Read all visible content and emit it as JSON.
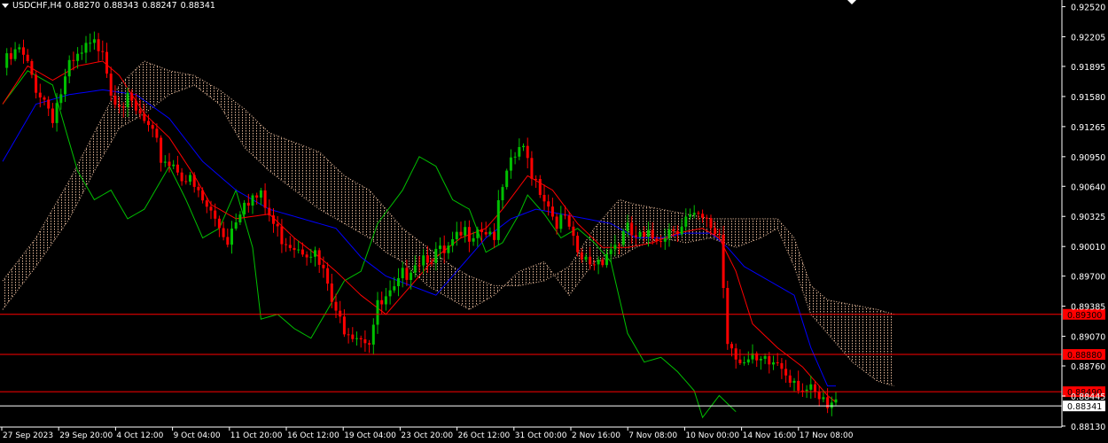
{
  "header": {
    "symbol": "USDCHF,H4",
    "open": "0.88270",
    "high": "0.88343",
    "low": "0.88247",
    "close": "0.88341"
  },
  "colors": {
    "background": "#000000",
    "bull_candle": "#00c000",
    "bear_candle": "#ff0000",
    "tenkan": "#ff0000",
    "kijun": "#0000ff",
    "chikou": "#00c000",
    "cloud_dots": "#f5c6a5",
    "level_line": "#ff0000",
    "price_line": "#ffffff"
  },
  "chart_data": {
    "type": "candlestick",
    "symbol": "USDCHF",
    "timeframe": "H4",
    "ylim": [
      0.8812,
      0.9259
    ],
    "y_ticks": [
      "0.92520",
      "0.92205",
      "0.91895",
      "0.91580",
      "0.91265",
      "0.90950",
      "0.90640",
      "0.90325",
      "0.90010",
      "0.89700",
      "0.89385",
      "0.89070",
      "0.88760",
      "0.88445",
      "0.88130"
    ],
    "x_ticks": [
      "27 Sep 2023",
      "29 Sep 20:00",
      "4 Oct 12:00",
      "9 Oct 04:00",
      "11 Oct 20:00",
      "16 Oct 12:00",
      "19 Oct 04:00",
      "23 Oct 20:00",
      "26 Oct 12:00",
      "31 Oct 00:00",
      "2 Nov 16:00",
      "7 Nov 08:00",
      "10 Nov 00:00",
      "14 Nov 16:00",
      "17 Nov 08:00"
    ],
    "horizontal_levels": [
      {
        "label": "0.89300",
        "value": 0.893
      },
      {
        "label": "0.88880",
        "value": 0.8888
      },
      {
        "label": "0.88490",
        "value": 0.8849
      }
    ],
    "current_price": {
      "label": "0.88341",
      "value": 0.88341
    },
    "close_path": [
      [
        0,
        0.9188
      ],
      [
        4,
        0.9205
      ],
      [
        8,
        0.917
      ],
      [
        12,
        0.914
      ],
      [
        16,
        0.9185
      ],
      [
        20,
        0.9205
      ],
      [
        24,
        0.9215
      ],
      [
        26,
        0.9165
      ],
      [
        30,
        0.915
      ],
      [
        34,
        0.913
      ],
      [
        38,
        0.9095
      ],
      [
        42,
        0.9085
      ],
      [
        46,
        0.906
      ],
      [
        50,
        0.9035
      ],
      [
        54,
        0.901
      ],
      [
        58,
        0.9055
      ],
      [
        62,
        0.905
      ],
      [
        66,
        0.9015
      ],
      [
        70,
        0.9005
      ],
      [
        74,
        0.9
      ],
      [
        78,
        0.896
      ],
      [
        80,
        0.8925
      ],
      [
        84,
        0.8915
      ],
      [
        88,
        0.8905
      ],
      [
        90,
        0.8935
      ],
      [
        94,
        0.895
      ],
      [
        98,
        0.8985
      ],
      [
        102,
        0.8995
      ],
      [
        106,
        0.899
      ],
      [
        110,
        0.901
      ],
      [
        114,
        0.9025
      ],
      [
        118,
        0.9015
      ],
      [
        120,
        0.906
      ],
      [
        124,
        0.9105
      ],
      [
        126,
        0.909
      ],
      [
        130,
        0.9055
      ],
      [
        132,
        0.9035
      ],
      [
        136,
        0.902
      ],
      [
        138,
        0.8985
      ],
      [
        142,
        0.8985
      ],
      [
        146,
        0.9
      ],
      [
        150,
        0.9015
      ],
      [
        154,
        0.9005
      ],
      [
        158,
        0.9015
      ],
      [
        160,
        0.902
      ],
      [
        164,
        0.903
      ],
      [
        168,
        0.9025
      ],
      [
        172,
        0.9015
      ],
      [
        174,
        0.8905
      ],
      [
        178,
        0.888
      ],
      [
        182,
        0.8875
      ],
      [
        186,
        0.888
      ],
      [
        190,
        0.8865
      ],
      [
        194,
        0.8845
      ],
      [
        198,
        0.883
      ],
      [
        200,
        0.8834
      ]
    ],
    "tenkan_path": [
      [
        0,
        0.915
      ],
      [
        6,
        0.919
      ],
      [
        12,
        0.9175
      ],
      [
        18,
        0.919
      ],
      [
        24,
        0.9195
      ],
      [
        28,
        0.918
      ],
      [
        34,
        0.914
      ],
      [
        40,
        0.9115
      ],
      [
        46,
        0.9075
      ],
      [
        50,
        0.9045
      ],
      [
        56,
        0.903
      ],
      [
        64,
        0.9035
      ],
      [
        70,
        0.901
      ],
      [
        76,
        0.899
      ],
      [
        80,
        0.8975
      ],
      [
        86,
        0.895
      ],
      [
        92,
        0.893
      ],
      [
        98,
        0.896
      ],
      [
        104,
        0.899
      ],
      [
        110,
        0.901
      ],
      [
        116,
        0.902
      ],
      [
        120,
        0.904
      ],
      [
        126,
        0.9075
      ],
      [
        132,
        0.906
      ],
      [
        138,
        0.9025
      ],
      [
        144,
        0.9
      ],
      [
        150,
        0.9
      ],
      [
        156,
        0.9005
      ],
      [
        162,
        0.9015
      ],
      [
        168,
        0.902
      ],
      [
        172,
        0.901
      ],
      [
        176,
        0.8975
      ],
      [
        180,
        0.892
      ],
      [
        186,
        0.8895
      ],
      [
        192,
        0.8875
      ],
      [
        198,
        0.8845
      ],
      [
        200,
        0.8838
      ]
    ],
    "kijun_path": [
      [
        0,
        0.909
      ],
      [
        8,
        0.915
      ],
      [
        16,
        0.916
      ],
      [
        24,
        0.9165
      ],
      [
        32,
        0.916
      ],
      [
        40,
        0.9135
      ],
      [
        48,
        0.909
      ],
      [
        56,
        0.906
      ],
      [
        64,
        0.904
      ],
      [
        72,
        0.903
      ],
      [
        80,
        0.902
      ],
      [
        86,
        0.899
      ],
      [
        92,
        0.897
      ],
      [
        98,
        0.896
      ],
      [
        104,
        0.895
      ],
      [
        110,
        0.898
      ],
      [
        116,
        0.901
      ],
      [
        122,
        0.903
      ],
      [
        128,
        0.904
      ],
      [
        134,
        0.9035
      ],
      [
        140,
        0.903
      ],
      [
        146,
        0.9025
      ],
      [
        152,
        0.901
      ],
      [
        158,
        0.901
      ],
      [
        164,
        0.9015
      ],
      [
        170,
        0.9015
      ],
      [
        174,
        0.9
      ],
      [
        178,
        0.898
      ],
      [
        184,
        0.8965
      ],
      [
        190,
        0.895
      ],
      [
        194,
        0.8895
      ],
      [
        198,
        0.8855
      ],
      [
        200,
        0.8855
      ]
    ],
    "chikou_path": [
      [
        0,
        0.915
      ],
      [
        6,
        0.9185
      ],
      [
        12,
        0.917
      ],
      [
        18,
        0.908
      ],
      [
        22,
        0.905
      ],
      [
        26,
        0.906
      ],
      [
        30,
        0.903
      ],
      [
        34,
        0.904
      ],
      [
        38,
        0.907
      ],
      [
        40,
        0.9085
      ],
      [
        44,
        0.905
      ],
      [
        48,
        0.901
      ],
      [
        52,
        0.902
      ],
      [
        56,
        0.906
      ],
      [
        60,
        0.9
      ],
      [
        62,
        0.8925
      ],
      [
        66,
        0.893
      ],
      [
        70,
        0.8915
      ],
      [
        74,
        0.8905
      ],
      [
        78,
        0.8935
      ],
      [
        82,
        0.8965
      ],
      [
        86,
        0.8975
      ],
      [
        90,
        0.9025
      ],
      [
        96,
        0.906
      ],
      [
        100,
        0.9095
      ],
      [
        104,
        0.9085
      ],
      [
        108,
        0.905
      ],
      [
        112,
        0.904
      ],
      [
        116,
        0.8995
      ],
      [
        120,
        0.9005
      ],
      [
        124,
        0.9035
      ],
      [
        126,
        0.9055
      ],
      [
        130,
        0.9035
      ],
      [
        134,
        0.901
      ],
      [
        138,
        0.902
      ],
      [
        142,
        0.9005
      ],
      [
        146,
        0.8985
      ],
      [
        150,
        0.891
      ],
      [
        154,
        0.888
      ],
      [
        158,
        0.8885
      ],
      [
        162,
        0.887
      ],
      [
        166,
        0.885
      ],
      [
        168,
        0.8822
      ],
      [
        172,
        0.8845
      ],
      [
        176,
        0.8828
      ]
    ],
    "cloud_upper_path": [
      [
        0,
        0.8965
      ],
      [
        8,
        0.901
      ],
      [
        16,
        0.907
      ],
      [
        22,
        0.912
      ],
      [
        28,
        0.917
      ],
      [
        34,
        0.9195
      ],
      [
        40,
        0.9185
      ],
      [
        46,
        0.918
      ],
      [
        52,
        0.9165
      ],
      [
        58,
        0.9145
      ],
      [
        64,
        0.912
      ],
      [
        70,
        0.911
      ],
      [
        76,
        0.91
      ],
      [
        82,
        0.9075
      ],
      [
        88,
        0.906
      ],
      [
        92,
        0.904
      ],
      [
        96,
        0.902
      ],
      [
        102,
        0.9
      ],
      [
        108,
        0.898
      ],
      [
        112,
        0.897
      ],
      [
        118,
        0.896
      ],
      [
        124,
        0.896
      ],
      [
        130,
        0.8965
      ],
      [
        136,
        0.898
      ],
      [
        142,
        0.902
      ],
      [
        148,
        0.905
      ],
      [
        152,
        0.9045
      ],
      [
        158,
        0.904
      ],
      [
        164,
        0.9035
      ],
      [
        170,
        0.903
      ],
      [
        176,
        0.903
      ],
      [
        182,
        0.903
      ],
      [
        186,
        0.903
      ],
      [
        190,
        0.901
      ],
      [
        194,
        0.896
      ],
      [
        198,
        0.8945
      ],
      [
        204,
        0.894
      ],
      [
        210,
        0.8935
      ],
      [
        214,
        0.893
      ]
    ],
    "cloud_lower_path": [
      [
        0,
        0.8935
      ],
      [
        8,
        0.898
      ],
      [
        16,
        0.903
      ],
      [
        22,
        0.908
      ],
      [
        28,
        0.9125
      ],
      [
        34,
        0.914
      ],
      [
        40,
        0.916
      ],
      [
        46,
        0.917
      ],
      [
        52,
        0.915
      ],
      [
        58,
        0.9105
      ],
      [
        64,
        0.908
      ],
      [
        70,
        0.906
      ],
      [
        76,
        0.904
      ],
      [
        82,
        0.9025
      ],
      [
        88,
        0.901
      ],
      [
        92,
        0.8995
      ],
      [
        96,
        0.8985
      ],
      [
        102,
        0.896
      ],
      [
        108,
        0.8945
      ],
      [
        112,
        0.8935
      ],
      [
        118,
        0.895
      ],
      [
        124,
        0.8975
      ],
      [
        130,
        0.8985
      ],
      [
        136,
        0.895
      ],
      [
        142,
        0.8985
      ],
      [
        148,
        0.899
      ],
      [
        152,
        0.9
      ],
      [
        158,
        0.901
      ],
      [
        164,
        0.9005
      ],
      [
        170,
        0.901
      ],
      [
        176,
        0.9
      ],
      [
        182,
        0.901
      ],
      [
        186,
        0.902
      ],
      [
        190,
        0.898
      ],
      [
        194,
        0.893
      ],
      [
        198,
        0.891
      ],
      [
        204,
        0.888
      ],
      [
        210,
        0.886
      ],
      [
        214,
        0.8855
      ]
    ]
  }
}
